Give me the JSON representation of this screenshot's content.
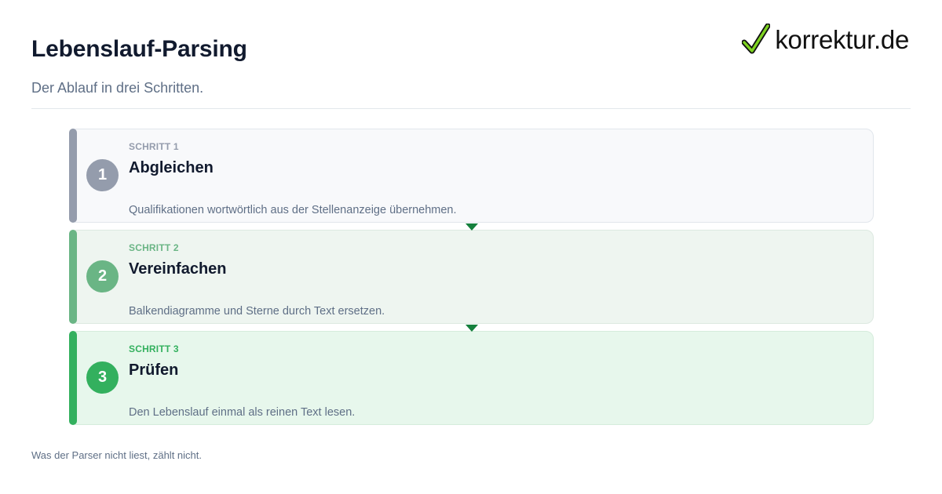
{
  "header": {
    "title": "Lebenslauf-Parsing",
    "subtitle": "Der Ablauf in drei Schritten."
  },
  "logo": {
    "text": "korrektur.de",
    "icon": "checkmark-icon",
    "icon_color": "#7ed321"
  },
  "steps": [
    {
      "number": "1",
      "label": "SCHRITT 1",
      "heading": "Abgleichen",
      "description": "Qualifikationen wortwörtlich aus der Stellenanzeige übernehmen.",
      "accent_color": "#949cac"
    },
    {
      "number": "2",
      "label": "SCHRITT 2",
      "heading": "Vereinfachen",
      "description": "Balkendiagramme und Sterne durch Text ersetzen.",
      "accent_color": "#6ab585"
    },
    {
      "number": "3",
      "label": "SCHRITT 3",
      "heading": "Prüfen",
      "description": "Den Lebenslauf einmal als reinen Text lesen.",
      "accent_color": "#33b05e"
    }
  ],
  "footer": {
    "note": "Was der Parser nicht liest, zählt nicht."
  }
}
